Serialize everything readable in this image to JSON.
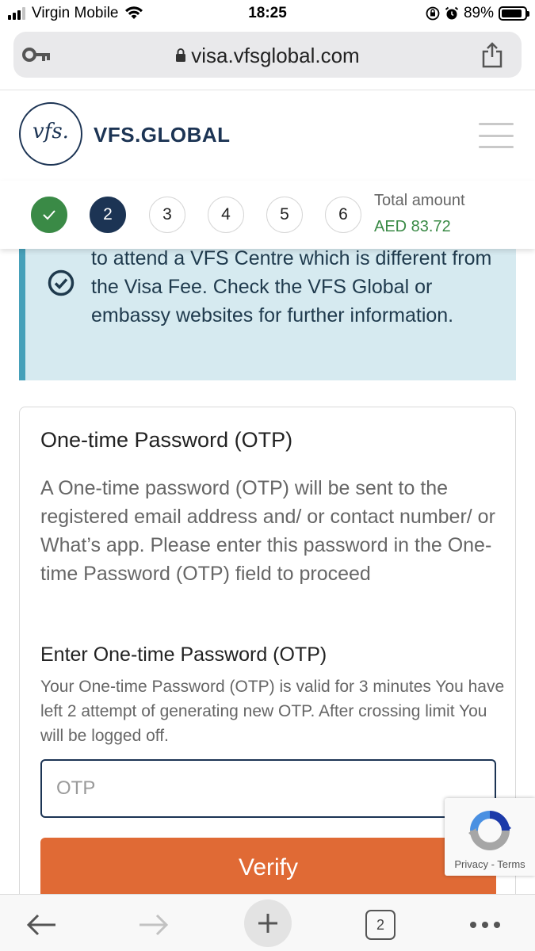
{
  "status_bar": {
    "carrier": "Virgin Mobile",
    "time": "18:25",
    "battery": "89%"
  },
  "browser": {
    "url": "visa.vfsglobal.com",
    "open_tabs": "2"
  },
  "header": {
    "logo_text": "vfs.",
    "brand": "VFS.GLOBAL"
  },
  "stepper": {
    "steps": [
      "2",
      "3",
      "4",
      "5",
      "6"
    ],
    "total_label": "Total amount",
    "total_amount": "AED 83.72",
    "colors": {
      "done": "#3a8a46",
      "active": "#1c3454"
    }
  },
  "info": {
    "text": "to attend a VFS Centre which is different from the Visa Fee. Check the VFS Global or embassy websites for further information."
  },
  "otp_card": {
    "title": "One-time Password (OTP)",
    "description": "A One-time password (OTP) will be sent to the registered email address and/ or contact number/ or What’s app. Please enter this password in the One-time Password (OTP) field to proceed",
    "field_label": "Enter One-time Password (OTP)",
    "hint": "Your One-time Password (OTP) is valid for 3 minutes You have left 2 attempt of generating new OTP. After crossing limit You will be logged off.",
    "input_placeholder": "OTP",
    "input_value": "",
    "verify_label": "Verify",
    "accent": "#e06a35"
  },
  "recaptcha": {
    "privacy": "Privacy",
    "separator": " - ",
    "terms": "Terms"
  }
}
